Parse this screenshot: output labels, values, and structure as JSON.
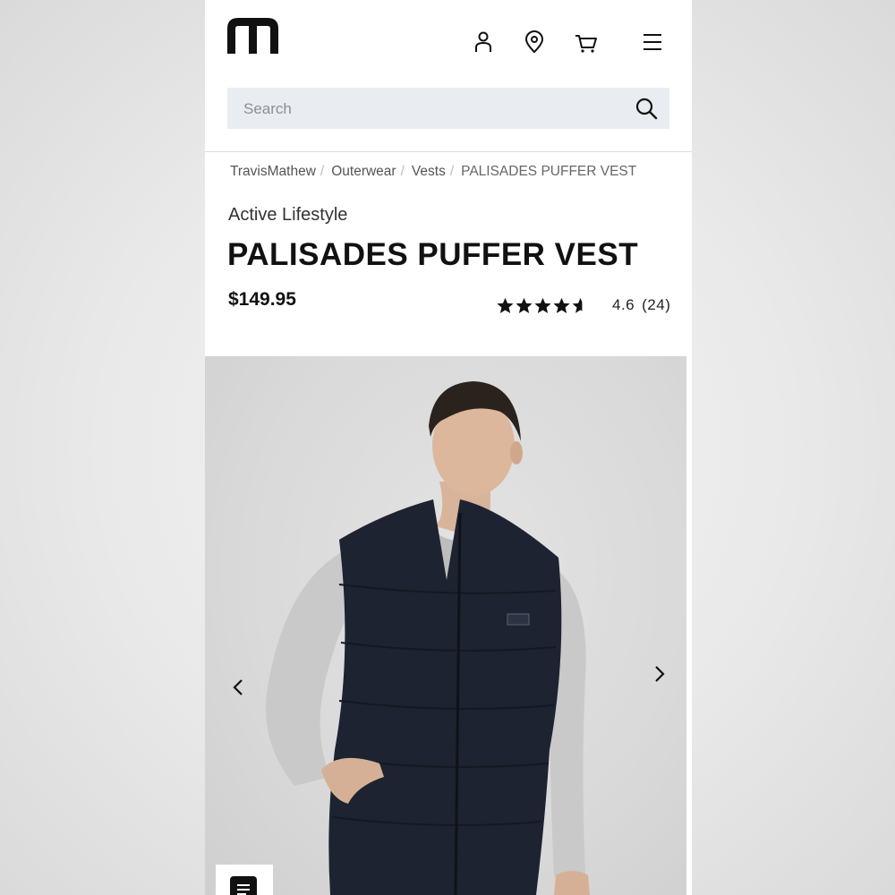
{
  "header": {
    "logo": "travismathew-logo",
    "icons": [
      "account-icon",
      "store-locator-icon",
      "cart-icon",
      "menu-icon"
    ]
  },
  "search": {
    "placeholder": "Search",
    "value": ""
  },
  "breadcrumb": {
    "items": [
      "TravisMathew",
      "Outerwear",
      "Vests",
      "PALISADES PUFFER VEST"
    ],
    "separator": "/"
  },
  "product": {
    "category": "Active Lifestyle",
    "title": "PALISADES PUFFER VEST",
    "price": "$149.95",
    "rating": {
      "value": 4.6,
      "score_text": "4.6",
      "count_text": "(24)",
      "max": 5
    }
  },
  "gallery": {
    "image": "product-photo",
    "controls": [
      "previous-arrow-icon",
      "next-arrow-icon"
    ]
  },
  "colors": {
    "text": "#111111",
    "search_bg": "#e9edf1",
    "vest": "#1d2330",
    "sleeve": "#c9c9c9"
  }
}
